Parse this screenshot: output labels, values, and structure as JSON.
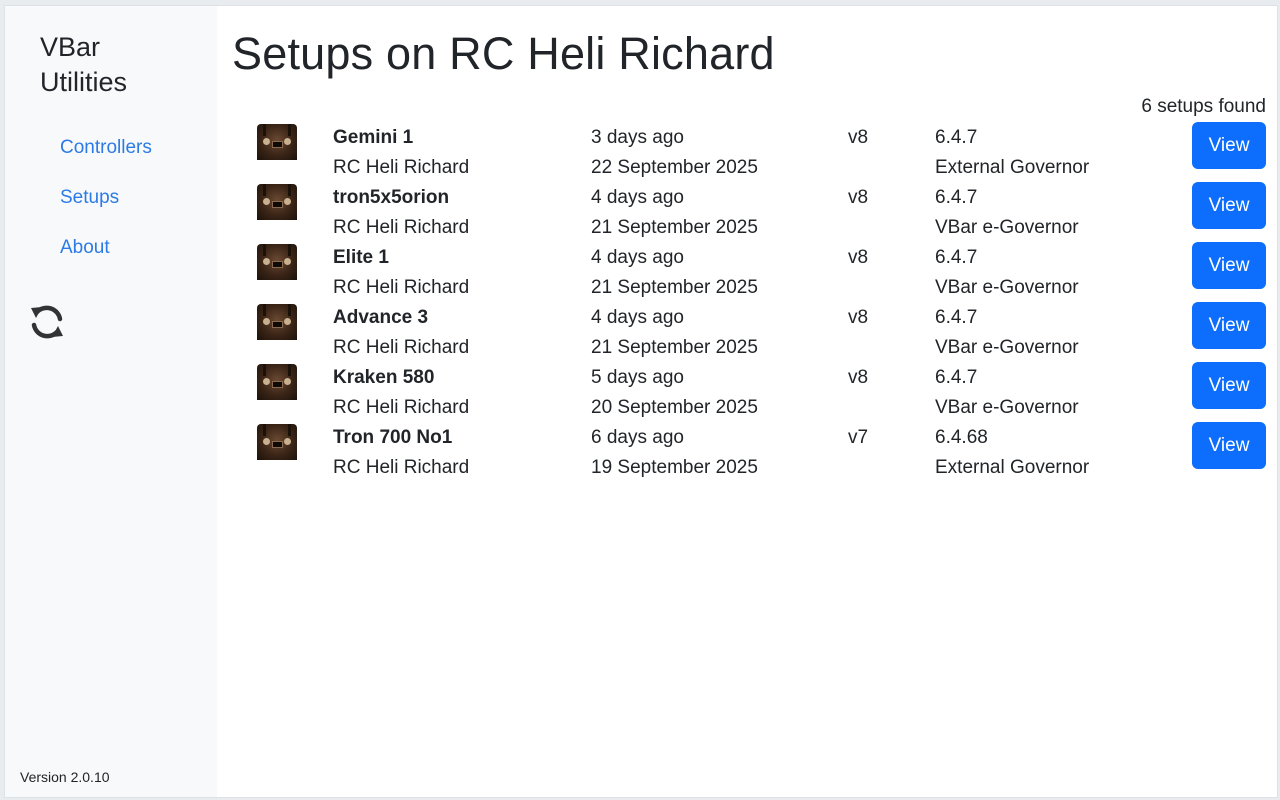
{
  "sidebar": {
    "brand": "VBar Utilities",
    "nav": [
      {
        "label": "Controllers"
      },
      {
        "label": "Setups"
      },
      {
        "label": "About"
      }
    ],
    "refresh_icon": "refresh-icon",
    "version": "Version 2.0.10"
  },
  "main": {
    "title": "Setups on RC Heli Richard",
    "count": "6 setups found",
    "view_label": "View",
    "setups": [
      {
        "name": "Gemini 1",
        "device": "RC Heli Richard",
        "ago": "3 days ago",
        "date": "22 September 2025",
        "hw": "v8",
        "fw": "6.4.7",
        "governor": "External Governor"
      },
      {
        "name": "tron5x5orion",
        "device": "RC Heli Richard",
        "ago": "4 days ago",
        "date": "21 September 2025",
        "hw": "v8",
        "fw": "6.4.7",
        "governor": "VBar e-Governor"
      },
      {
        "name": "Elite 1",
        "device": "RC Heli Richard",
        "ago": "4 days ago",
        "date": "21 September 2025",
        "hw": "v8",
        "fw": "6.4.7",
        "governor": "VBar e-Governor"
      },
      {
        "name": "Advance 3",
        "device": "RC Heli Richard",
        "ago": "4 days ago",
        "date": "21 September 2025",
        "hw": "v8",
        "fw": "6.4.7",
        "governor": "VBar e-Governor"
      },
      {
        "name": "Kraken 580",
        "device": "RC Heli Richard",
        "ago": "5 days ago",
        "date": "20 September 2025",
        "hw": "v8",
        "fw": "6.4.7",
        "governor": "VBar e-Governor"
      },
      {
        "name": "Tron 700 No1",
        "device": "RC Heli Richard",
        "ago": "6 days ago",
        "date": "19 September 2025",
        "hw": "v7",
        "fw": "6.4.68",
        "governor": "External Governor"
      }
    ]
  },
  "colors": {
    "accent": "#0d6efd",
    "link": "#2c7be5",
    "sidebar_bg": "#f8f9fa"
  }
}
